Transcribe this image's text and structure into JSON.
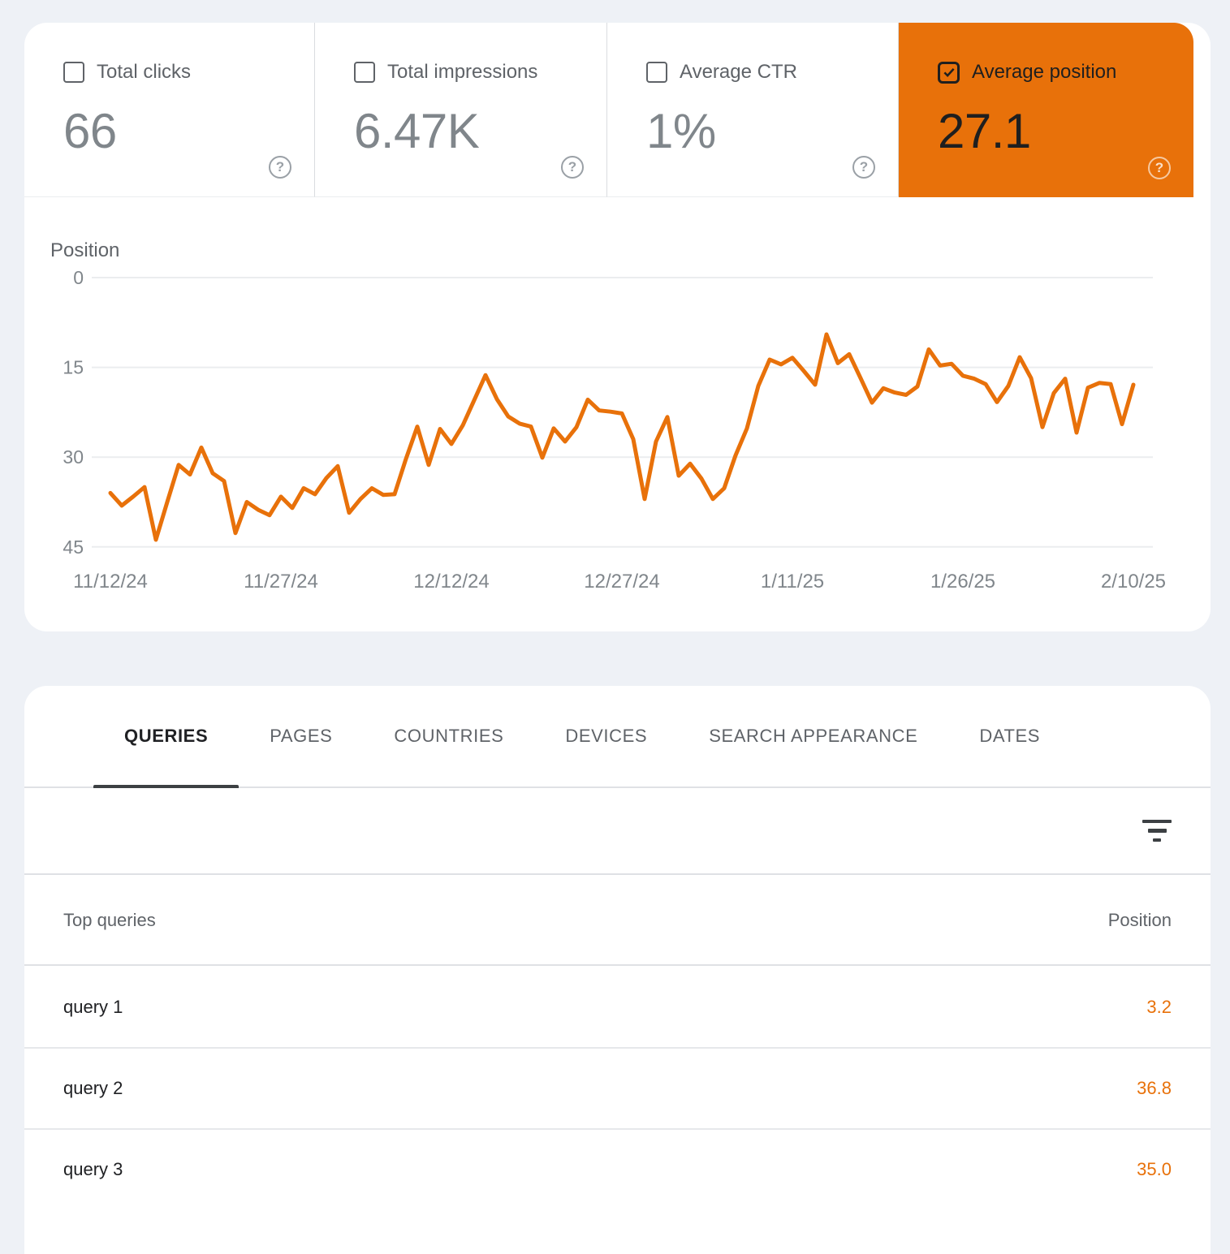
{
  "colors": {
    "accent_orange": "#e8710a",
    "page_bg": "#eef1f6",
    "card_bg": "#ffffff",
    "divider": "#dfe1e5",
    "gridline": "#ebedef",
    "axis_text": "#80868b",
    "label_gray": "#5f6368",
    "value_gray": "#80868b",
    "text_dark": "#202124",
    "tab_underline": "#3c4043"
  },
  "metrics": [
    {
      "label": "Total clicks",
      "value": "66",
      "checked": false,
      "selected": false,
      "help_icon": "?"
    },
    {
      "label": "Total impressions",
      "value": "6.47K",
      "checked": false,
      "selected": false,
      "help_icon": "?"
    },
    {
      "label": "Average CTR",
      "value": "1%",
      "checked": false,
      "selected": false,
      "help_icon": "?"
    },
    {
      "label": "Average position",
      "value": "27.1",
      "checked": true,
      "selected": true,
      "help_icon": "?"
    }
  ],
  "chart_data": {
    "type": "line",
    "title": "",
    "xlabel": "",
    "ylabel": "Position",
    "y_axis_inverted": true,
    "y_ticks": [
      0,
      15,
      30,
      45
    ],
    "ylim": [
      0,
      45
    ],
    "grid": true,
    "legend_position": "none",
    "x_tick_labels": [
      "11/12/24",
      "11/27/24",
      "12/12/24",
      "12/27/24",
      "1/11/25",
      "1/26/25",
      "2/10/25"
    ],
    "x_tick_day_indices": [
      0,
      15,
      30,
      45,
      60,
      75,
      90
    ],
    "series": [
      {
        "name": "Average position",
        "color": "#e8710a",
        "values": [
          36.0,
          38.1,
          36.6,
          35.0,
          43.8,
          37.5,
          31.3,
          32.9,
          28.4,
          32.7,
          34.0,
          42.7,
          37.5,
          38.8,
          39.7,
          36.6,
          38.5,
          35.2,
          36.2,
          33.5,
          31.5,
          39.3,
          37.0,
          35.2,
          36.3,
          36.2,
          30.3,
          24.9,
          31.3,
          25.3,
          27.8,
          24.7,
          20.5,
          16.3,
          20.3,
          23.2,
          24.4,
          24.9,
          30.1,
          25.2,
          27.4,
          25.0,
          20.4,
          22.2,
          22.4,
          22.7,
          27.0,
          37.0,
          27.4,
          23.3,
          33.1,
          31.1,
          33.6,
          37.0,
          35.2,
          29.7,
          25.2,
          18.1,
          13.7,
          14.5,
          13.4,
          15.6,
          17.9,
          9.5,
          14.3,
          12.8,
          16.8,
          20.9,
          18.5,
          19.2,
          19.6,
          18.2,
          12.0,
          14.7,
          14.4,
          16.4,
          16.9,
          17.8,
          20.8,
          18.1,
          13.3,
          16.8,
          25.0,
          19.3,
          16.9,
          25.9,
          18.4,
          17.6,
          17.8,
          24.5,
          17.9
        ]
      }
    ]
  },
  "tabs": [
    {
      "label": "QUERIES",
      "active": true
    },
    {
      "label": "PAGES",
      "active": false
    },
    {
      "label": "COUNTRIES",
      "active": false
    },
    {
      "label": "DEVICES",
      "active": false
    },
    {
      "label": "SEARCH APPEARANCE",
      "active": false
    },
    {
      "label": "DATES",
      "active": false
    }
  ],
  "table": {
    "query_header": "Top queries",
    "position_header": "Position",
    "rows": [
      {
        "query": "query 1",
        "position": "3.2"
      },
      {
        "query": "query 2",
        "position": "36.8"
      },
      {
        "query": "query 3",
        "position": "35.0"
      }
    ]
  }
}
